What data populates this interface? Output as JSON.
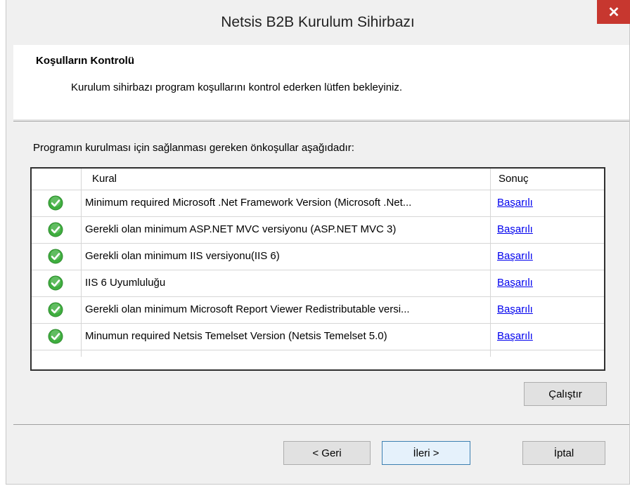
{
  "window": {
    "title": "Netsis B2B Kurulum Sihirbazı",
    "close_glyph": "✕"
  },
  "header": {
    "title": "Koşulların Kontrolü",
    "description": "Kurulum sihirbazı program koşullarını kontrol ederken lütfen bekleyiniz."
  },
  "prompt": "Programın kurulması için sağlanması gereken önkoşullar aşağıdadır:",
  "grid": {
    "columns": {
      "rule": "Kural",
      "result": "Sonuç"
    },
    "rows": [
      {
        "status_icon": "check-icon",
        "rule": "Minimum required Microsoft .Net Framework Version (Microsoft .Net...",
        "result": "Başarılı"
      },
      {
        "status_icon": "check-icon",
        "rule": "Gerekli olan minimum ASP.NET MVC versiyonu (ASP.NET MVC 3)",
        "result": "Başarılı"
      },
      {
        "status_icon": "check-icon",
        "rule": "Gerekli olan minimum IIS versiyonu(IIS 6)",
        "result": "Başarılı"
      },
      {
        "status_icon": "check-icon",
        "rule": "IIS 6 Uyumluluğu",
        "result": "Başarılı"
      },
      {
        "status_icon": "check-icon",
        "rule": "Gerekli olan minimum Microsoft Report Viewer Redistributable versi...",
        "result": "Başarılı"
      },
      {
        "status_icon": "check-icon",
        "rule": "Minumun required Netsis Temelset Version (Netsis Temelset 5.0)",
        "result": "Başarılı"
      }
    ]
  },
  "buttons": {
    "run": "Çalıştır",
    "back": "< Geri",
    "next": "İleri >",
    "cancel": "İptal"
  },
  "colors": {
    "success": "#3fae3f",
    "link": "#0000ee",
    "close": "#c7372f"
  }
}
